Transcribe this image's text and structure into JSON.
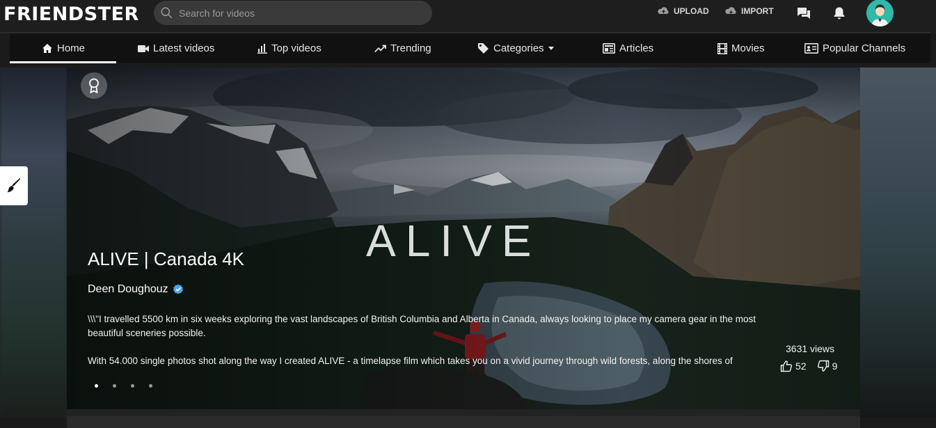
{
  "app": {
    "logo": "FRIENDSTER"
  },
  "search": {
    "placeholder": "Search for videos"
  },
  "toolbar": {
    "upload_label": "UPLOAD",
    "import_label": "IMPORT",
    "icons": [
      "upload-cloud-icon",
      "import-cloud-icon",
      "chat-icon",
      "bell-icon"
    ]
  },
  "nav": {
    "items": [
      {
        "label": "Home",
        "icon": "home-icon",
        "active": true
      },
      {
        "label": "Latest videos",
        "icon": "video-camera-icon"
      },
      {
        "label": "Top videos",
        "icon": "bar-chart-icon"
      },
      {
        "label": "Trending",
        "icon": "trending-up-icon"
      },
      {
        "label": "Categories",
        "icon": "tag-icon",
        "dropdown": true
      },
      {
        "label": "Articles",
        "icon": "newspaper-icon"
      },
      {
        "label": "Movies",
        "icon": "film-icon"
      },
      {
        "label": "Popular Channels",
        "icon": "id-card-icon"
      }
    ]
  },
  "featured": {
    "overlay_text": "ALIVE",
    "title": "ALIVE | Canada 4K",
    "channel": "Deen Doughouz",
    "verified": true,
    "description_1": "\\\\\\\"I travelled 5500 km in six weeks exploring the vast landscapes of British Columbia and Alberta in Canada, always looking to place my camera gear in the most beautiful sceneries possible.",
    "description_2": "With 54.000 single photos shot along the way I created ALIVE - a timelapse film which takes you on a vivid journey through wild forests, along the shores of",
    "views": "3631 views",
    "likes": "52",
    "dislikes": "9",
    "slide_count": 4,
    "active_slide": 1
  },
  "colors": {
    "accent": "#ffffff",
    "verified_badge": "#4aa3f0",
    "avatar_bg": "#2fb9a8"
  }
}
